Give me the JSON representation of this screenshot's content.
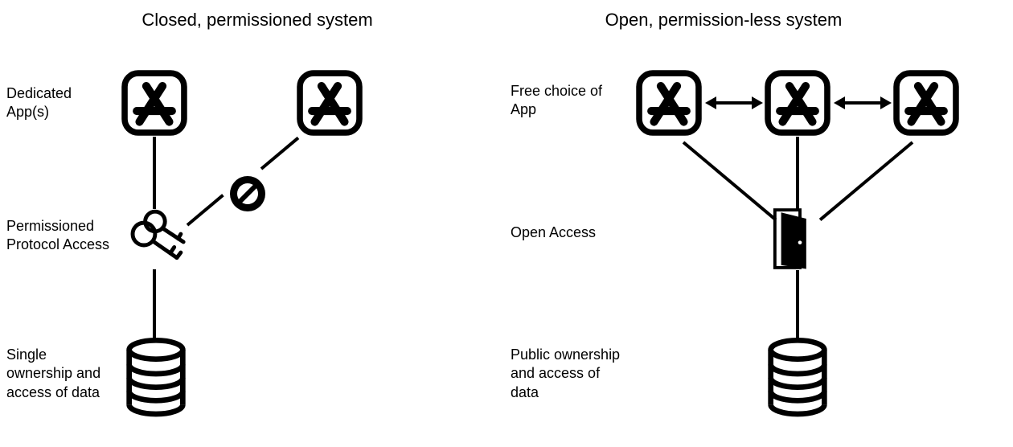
{
  "left": {
    "title": "Closed, permissioned system",
    "row1_label": "Dedicated App(s)",
    "row2_label": "Permissioned Protocol Access",
    "row3_label": "Single ownership  and access of data"
  },
  "right": {
    "title": "Open, permission-less system",
    "row1_label": "Free choice of App",
    "row2_label": "Open Access",
    "row3_label": "Public ownership and access of data"
  }
}
